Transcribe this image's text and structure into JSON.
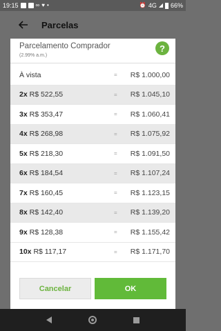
{
  "status": {
    "time": "19:15",
    "network": "4G",
    "battery": "66%"
  },
  "toolbar": {
    "title": "Parcelas"
  },
  "dialog": {
    "title": "Parcelamento Comprador",
    "subtitle": "(2.99% a.m.)",
    "help_label": "?"
  },
  "installments": [
    {
      "count": "",
      "value": "À vista",
      "total": "R$ 1.000,00"
    },
    {
      "count": "2x",
      "value": "R$ 522,55",
      "total": "R$ 1.045,10"
    },
    {
      "count": "3x",
      "value": "R$ 353,47",
      "total": "R$ 1.060,41"
    },
    {
      "count": "4x",
      "value": "R$ 268,98",
      "total": "R$ 1.075,92"
    },
    {
      "count": "5x",
      "value": "R$ 218,30",
      "total": "R$ 1.091,50"
    },
    {
      "count": "6x",
      "value": "R$ 184,54",
      "total": "R$ 1.107,24"
    },
    {
      "count": "7x",
      "value": "R$ 160,45",
      "total": "R$ 1.123,15"
    },
    {
      "count": "8x",
      "value": "R$ 142,40",
      "total": "R$ 1.139,20"
    },
    {
      "count": "9x",
      "value": "R$ 128,38",
      "total": "R$ 1.155,42"
    },
    {
      "count": "10x",
      "value": "R$ 117,17",
      "total": "R$ 1.171,70"
    }
  ],
  "equals_sign": "=",
  "buttons": {
    "cancel_label": "Cancelar",
    "ok_label": "OK"
  },
  "colors": {
    "accent": "#61ba39",
    "alt_row": "#e9e9e9"
  }
}
